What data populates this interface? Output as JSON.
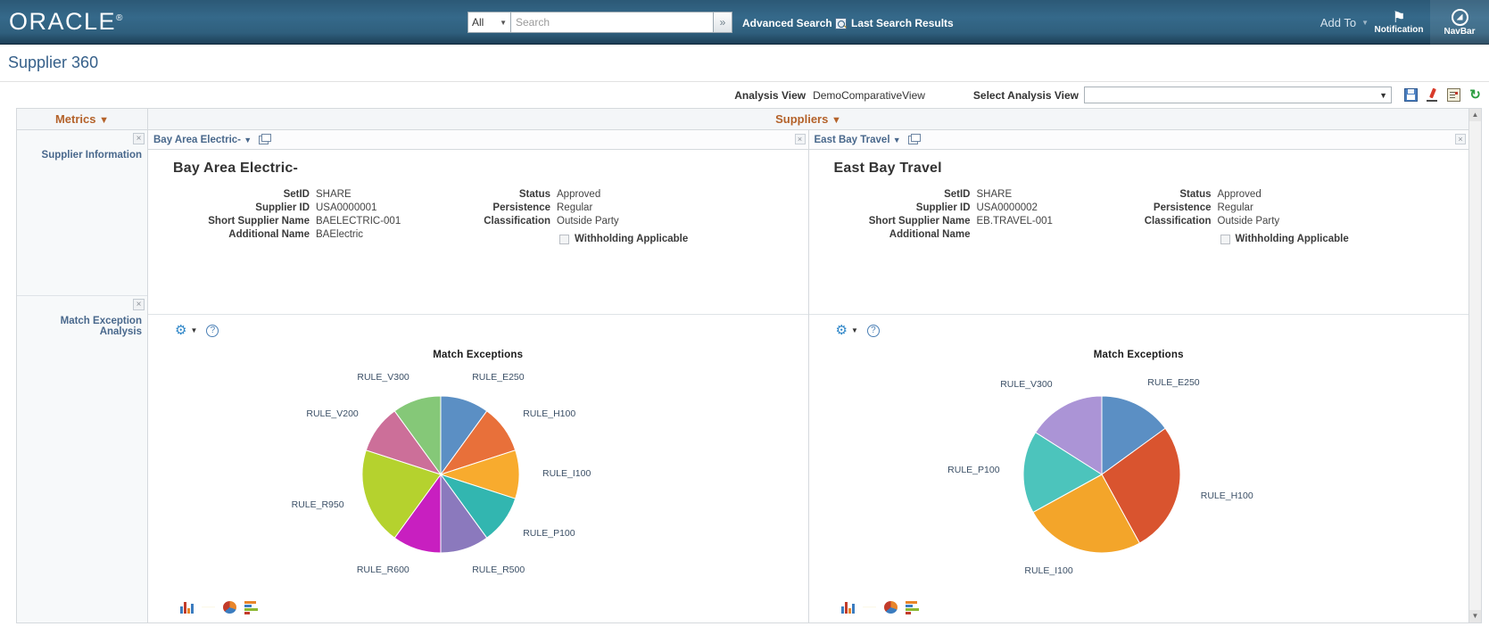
{
  "header": {
    "logo": "ORACLE",
    "search": {
      "scope": "All",
      "placeholder": "Search",
      "value": "",
      "go_label": "»"
    },
    "advanced_search": "Advanced Search",
    "last_search_results": "Last Search Results",
    "add_to": "Add To",
    "notification": "Notification",
    "navbar": "NavBar"
  },
  "page": {
    "title": "Supplier 360"
  },
  "analysis_bar": {
    "analysis_view_label": "Analysis View",
    "analysis_view_value": "DemoComparativeView",
    "select_analysis_view_label": "Select Analysis View",
    "select_analysis_view_value": "",
    "icons": [
      "save-icon",
      "edit-icon",
      "note-icon",
      "refresh-icon"
    ]
  },
  "grid": {
    "metrics_header": "Metrics",
    "suppliers_header": "Suppliers",
    "caret": "▼",
    "close_label": "×",
    "metrics": [
      {
        "label": "Supplier Information"
      },
      {
        "label": "Match Exception Analysis"
      }
    ],
    "supplier_tabs": [
      {
        "label": "Bay Area Electric-",
        "popout": "popout-icon"
      },
      {
        "label": "East Bay Travel",
        "popout": "popout-icon"
      }
    ]
  },
  "suppliers": [
    {
      "name": "Bay Area Electric-",
      "fields_left": [
        {
          "label": "SetID",
          "value": "SHARE"
        },
        {
          "label": "Supplier ID",
          "value": "USA0000001"
        },
        {
          "label": "Short Supplier Name",
          "value": "BAELECTRIC-001"
        },
        {
          "label": "Additional Name",
          "value": "BAElectric"
        }
      ],
      "fields_right": [
        {
          "label": "Status",
          "value": "Approved"
        },
        {
          "label": "Persistence",
          "value": "Regular"
        },
        {
          "label": "Classification",
          "value": "Outside Party"
        }
      ],
      "withholding_label": "Withholding Applicable",
      "withholding_checked": false
    },
    {
      "name": "East Bay Travel",
      "fields_left": [
        {
          "label": "SetID",
          "value": "SHARE"
        },
        {
          "label": "Supplier ID",
          "value": "USA0000002"
        },
        {
          "label": "Short Supplier Name",
          "value": "EB.TRAVEL-001"
        },
        {
          "label": "Additional Name",
          "value": ""
        }
      ],
      "fields_right": [
        {
          "label": "Status",
          "value": "Approved"
        },
        {
          "label": "Persistence",
          "value": "Regular"
        },
        {
          "label": "Classification",
          "value": "Outside Party"
        }
      ],
      "withholding_label": "Withholding Applicable",
      "withholding_checked": false
    }
  ],
  "chart_toolbar": {
    "gear": "gear-icon",
    "caret": "▼",
    "help": "?"
  },
  "chart_type_icons": [
    "bar-chart-icon",
    "line-chart-icon",
    "pie-chart-icon",
    "horizontal-bar-chart-icon"
  ],
  "chart_data": [
    {
      "type": "pie",
      "title": "Match Exceptions",
      "owner": "Bay Area Electric-",
      "labels": [
        "RULE_E250",
        "RULE_H100",
        "RULE_I100",
        "RULE_P100",
        "RULE_R500",
        "RULE_R600",
        "RULE_R950",
        "RULE_V200",
        "RULE_V300"
      ],
      "values": [
        9,
        9,
        9,
        9,
        9,
        9,
        18,
        9,
        9
      ],
      "colors": [
        "#5b8fc4",
        "#e8703a",
        "#f8ab2e",
        "#32b6b0",
        "#8b79bd",
        "#c81fc0",
        "#b5d22e",
        "#cc6f99",
        "#85c878"
      ],
      "legend": "labels-outside"
    },
    {
      "type": "pie",
      "title": "Match Exceptions",
      "owner": "East Bay Travel",
      "labels": [
        "RULE_E250",
        "RULE_H100",
        "RULE_I100",
        "RULE_P100",
        "RULE_V300"
      ],
      "values": [
        15,
        27,
        25,
        17,
        16
      ],
      "colors": [
        "#5b8fc4",
        "#d9542f",
        "#f3a52a",
        "#4cc4bc",
        "#ab94d6"
      ],
      "legend": "labels-outside"
    }
  ],
  "scrollbar": {
    "up": "▲",
    "down": "▼"
  }
}
